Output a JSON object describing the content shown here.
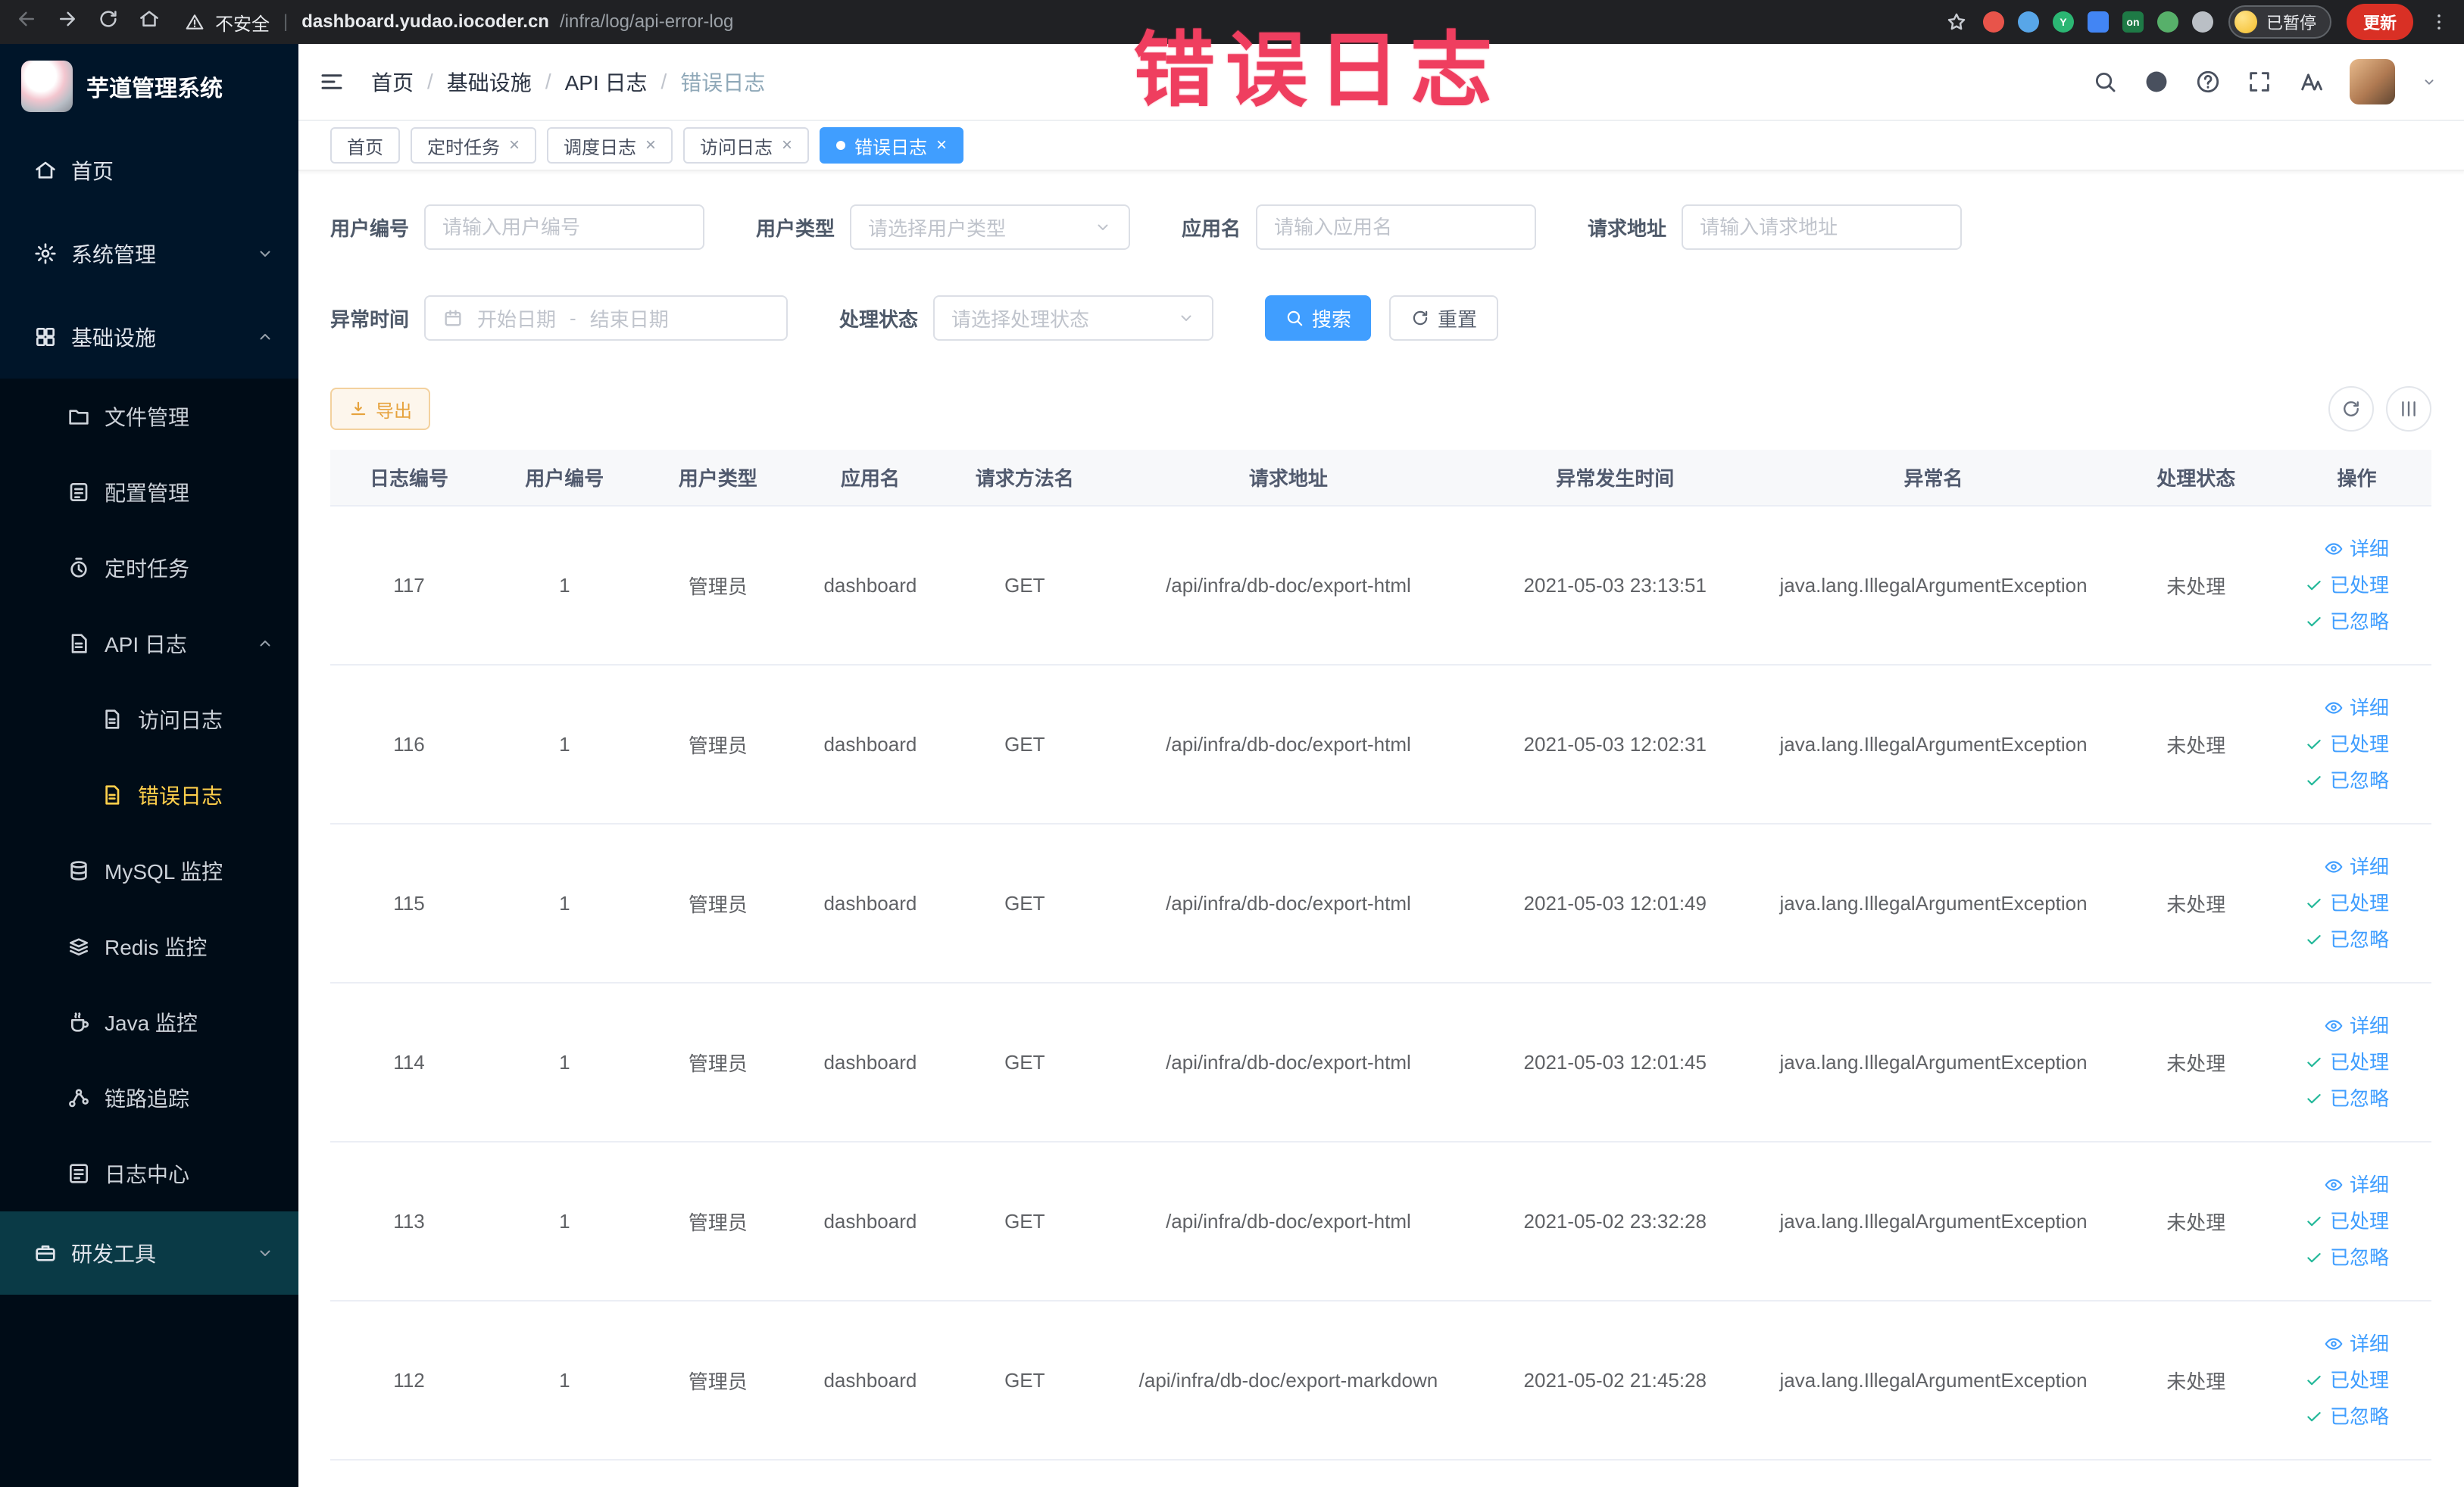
{
  "colors": {
    "accent": "#409eff",
    "sidebar_bg": "#001529",
    "sidebar_submenu_bg": "#000c17",
    "sidebar_active_text": "#ffd04b",
    "warn_button": "#e6a23c",
    "annotation": "#ef3e5f",
    "update_button": "#d93025"
  },
  "annotation": {
    "text": "错误日志"
  },
  "browser": {
    "nav_icons": [
      {
        "name": "back-icon",
        "disabled": true
      },
      {
        "name": "forward-icon",
        "disabled": false
      },
      {
        "name": "reload-icon",
        "disabled": false
      },
      {
        "name": "home-icon",
        "disabled": false
      }
    ],
    "security_label": "不安全",
    "url_host": "dashboard.yudao.iocoder.cn",
    "url_path": "/infra/log/api-error-log",
    "extensions": [
      {
        "name": "extension-red-icon",
        "color": "#e8544a",
        "round": true
      },
      {
        "name": "extension-blue-icon",
        "color": "#58a6e8",
        "round": true
      },
      {
        "name": "extension-green-circle-icon",
        "color": "#2bb673",
        "round": true,
        "text": "Y"
      },
      {
        "name": "extension-blue-grid-icon",
        "color": "#4285f4",
        "round": false
      },
      {
        "name": "extension-on-badge-icon",
        "color": "#1e7a46",
        "round": false,
        "text": "on"
      },
      {
        "name": "extension-leaf-icon",
        "color": "#57b06a",
        "round": true
      },
      {
        "name": "extension-dark-icon",
        "color": "#babfc5",
        "round": true
      }
    ],
    "paused_badge": "已暂停",
    "update_label": "更新"
  },
  "sidebar": {
    "logo_title": "芋道管理系统",
    "menu": [
      {
        "key": "home",
        "label": "首页",
        "icon": "home-icon",
        "level": 1
      },
      {
        "key": "system-management",
        "label": "系统管理",
        "icon": "gear-icon",
        "level": 1,
        "chevron": "down"
      },
      {
        "key": "infrastructure",
        "label": "基础设施",
        "icon": "infra-icon",
        "level": 1,
        "chevron": "up"
      },
      {
        "key": "file-management",
        "label": "文件管理",
        "icon": "folder-icon",
        "level": 2
      },
      {
        "key": "config-management",
        "label": "配置管理",
        "icon": "config-icon",
        "level": 2
      },
      {
        "key": "scheduled-tasks",
        "label": "定时任务",
        "icon": "timer-icon",
        "level": 2
      },
      {
        "key": "api-log",
        "label": "API 日志",
        "icon": "api-log-icon",
        "level": 2,
        "chevron": "up"
      },
      {
        "key": "access-log",
        "label": "访问日志",
        "icon": "doc-icon",
        "level": 3
      },
      {
        "key": "error-log",
        "label": "错误日志",
        "icon": "doc-icon",
        "level": 3,
        "active": true
      },
      {
        "key": "mysql-monitor",
        "label": "MySQL 监控",
        "icon": "mysql-icon",
        "level": 2
      },
      {
        "key": "redis-monitor",
        "label": "Redis 监控",
        "icon": "redis-icon",
        "level": 2
      },
      {
        "key": "java-monitor",
        "label": "Java 监控",
        "icon": "java-icon",
        "level": 2
      },
      {
        "key": "trace",
        "label": "链路追踪",
        "icon": "trace-icon",
        "level": 2
      },
      {
        "key": "log-center",
        "label": "日志中心",
        "icon": "log-center-icon",
        "level": 2
      },
      {
        "key": "dev-tools",
        "label": "研发工具",
        "icon": "tools-icon",
        "level": 1,
        "chevron": "down",
        "highlight": true
      }
    ]
  },
  "breadcrumb": {
    "items": [
      "首页",
      "基础设施",
      "API 日志",
      "错误日志"
    ]
  },
  "topbar": {
    "icons": [
      "search-icon",
      "github-icon",
      "question-icon",
      "fullscreen-icon",
      "font-size-icon"
    ]
  },
  "tabs": [
    {
      "label": "首页",
      "closable": false,
      "active": false
    },
    {
      "label": "定时任务",
      "closable": true,
      "active": false
    },
    {
      "label": "调度日志",
      "closable": true,
      "active": false
    },
    {
      "label": "访问日志",
      "closable": true,
      "active": false
    },
    {
      "label": "错误日志",
      "closable": true,
      "active": true
    }
  ],
  "filters": {
    "user_id": {
      "label": "用户编号",
      "placeholder": "请输入用户编号"
    },
    "user_type": {
      "label": "用户类型",
      "placeholder": "请选择用户类型"
    },
    "app_name": {
      "label": "应用名",
      "placeholder": "请输入应用名"
    },
    "request_url": {
      "label": "请求地址",
      "placeholder": "请输入请求地址"
    },
    "exception_time": {
      "label": "异常时间",
      "start_placeholder": "开始日期",
      "separator": "-",
      "end_placeholder": "结束日期"
    },
    "process_status": {
      "label": "处理状态",
      "placeholder": "请选择处理状态"
    },
    "search_label": "搜索",
    "reset_label": "重置"
  },
  "toolbar": {
    "export_label": "导出"
  },
  "table": {
    "columns": [
      "日志编号",
      "用户编号",
      "用户类型",
      "应用名",
      "请求方法名",
      "请求地址",
      "异常发生时间",
      "异常名",
      "处理状态",
      "操作"
    ],
    "rows": [
      {
        "id": "117",
        "user_id": "1",
        "user_type": "管理员",
        "app": "dashboard",
        "method": "GET",
        "url": "/api/infra/db-doc/export-html",
        "time": "2021-05-03 23:13:51",
        "exception": "java.lang.IllegalArgumentException",
        "status": "未处理"
      },
      {
        "id": "116",
        "user_id": "1",
        "user_type": "管理员",
        "app": "dashboard",
        "method": "GET",
        "url": "/api/infra/db-doc/export-html",
        "time": "2021-05-03 12:02:31",
        "exception": "java.lang.IllegalArgumentException",
        "status": "未处理"
      },
      {
        "id": "115",
        "user_id": "1",
        "user_type": "管理员",
        "app": "dashboard",
        "method": "GET",
        "url": "/api/infra/db-doc/export-html",
        "time": "2021-05-03 12:01:49",
        "exception": "java.lang.IllegalArgumentException",
        "status": "未处理"
      },
      {
        "id": "114",
        "user_id": "1",
        "user_type": "管理员",
        "app": "dashboard",
        "method": "GET",
        "url": "/api/infra/db-doc/export-html",
        "time": "2021-05-03 12:01:45",
        "exception": "java.lang.IllegalArgumentException",
        "status": "未处理"
      },
      {
        "id": "113",
        "user_id": "1",
        "user_type": "管理员",
        "app": "dashboard",
        "method": "GET",
        "url": "/api/infra/db-doc/export-html",
        "time": "2021-05-02 23:32:28",
        "exception": "java.lang.IllegalArgumentException",
        "status": "未处理"
      },
      {
        "id": "112",
        "user_id": "1",
        "user_type": "管理员",
        "app": "dashboard",
        "method": "GET",
        "url": "/api/infra/db-doc/export-markdown",
        "time": "2021-05-02 21:45:28",
        "exception": "java.lang.IllegalArgumentException",
        "status": "未处理"
      }
    ],
    "actions": {
      "detail": "详细",
      "processed": "已处理",
      "ignored": "已忽略"
    }
  }
}
